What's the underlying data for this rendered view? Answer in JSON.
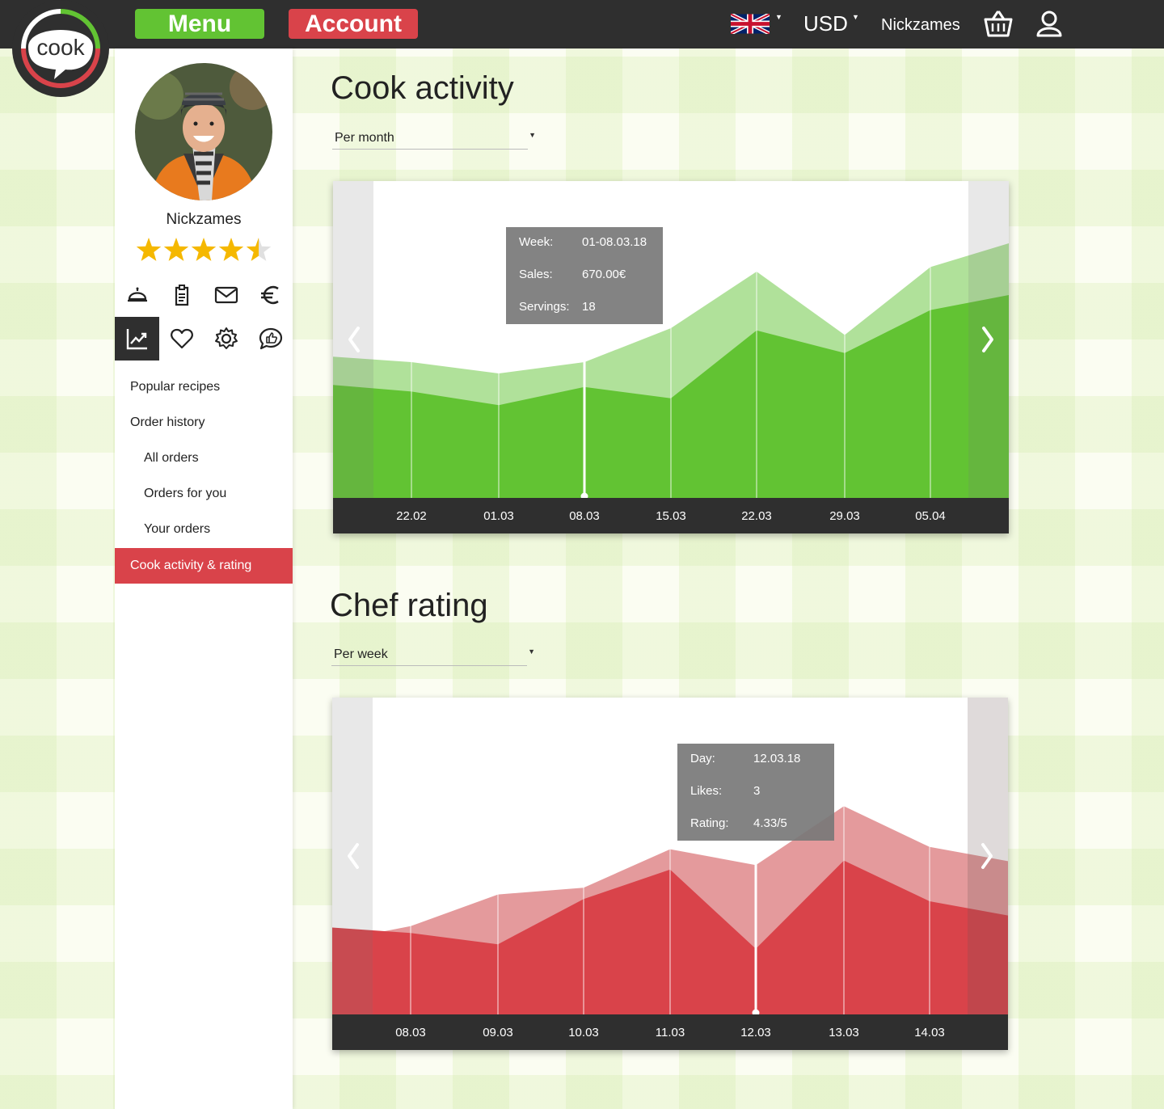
{
  "header": {
    "menu_label": "Menu",
    "account_label": "Account",
    "language_icon": "uk-flag-icon",
    "currency": "USD",
    "username": "Nickzames",
    "basket_icon": "basket-icon",
    "profile_icon": "user-icon"
  },
  "logo": {
    "text": "cook"
  },
  "sidebar": {
    "name": "Nickzames",
    "rating": 4.5,
    "rating_max": 5,
    "icons": [
      "cloche-icon",
      "clipboard-icon",
      "mail-icon",
      "euro-icon",
      "chart-icon",
      "heart-icon",
      "gear-icon",
      "chat-thumb-icon"
    ],
    "links": [
      "Popular recipes",
      "Order history",
      "All orders",
      "Orders for you",
      "Your orders"
    ],
    "active_link": "Cook activity & rating"
  },
  "activity": {
    "title": "Cook activity",
    "select_value": "Per month",
    "tooltip": {
      "week_label": "Week:",
      "week_value": "01-08.03.18",
      "sales_label": "Sales:",
      "sales_value": "670.00€",
      "servings_label": "Servings:",
      "servings_value": "18"
    }
  },
  "rating": {
    "title": "Chef rating",
    "select_value": "Per week",
    "tooltip": {
      "day_label": "Day:",
      "day_value": "12.03.18",
      "likes_label": "Likes:",
      "likes_value": "3",
      "rating_label": "Rating:",
      "rating_value": "4.33/5"
    }
  },
  "colors": {
    "green": "#62c333",
    "green_light": "#b0e19a",
    "red": "#d9434a",
    "red_light": "#e49a9c",
    "dark": "#2f2f2f"
  },
  "chart_data": [
    {
      "type": "area",
      "categories": [
        "22.02",
        "01.03",
        "08.03",
        "15.03",
        "22.03",
        "29.03",
        "05.04"
      ],
      "series": [
        {
          "values": [
            6,
            5.5,
            6,
            7.5,
            10,
            7.2,
            10.2
          ]
        },
        {
          "values": [
            4.7,
            4.1,
            4.9,
            4.4,
            7.4,
            6.4,
            8.3
          ]
        }
      ],
      "ylim": [
        0,
        14
      ],
      "grid": true
    },
    {
      "type": "area",
      "categories": [
        "08.03",
        "09.03",
        "10.03",
        "11.03",
        "12.03",
        "13.03",
        "14.03"
      ],
      "series": [
        {
          "values": [
            3.9,
            5.3,
            5.6,
            7.3,
            6.6,
            9.2,
            7.4
          ]
        },
        {
          "values": [
            3.6,
            3.1,
            5.1,
            6.4,
            2.9,
            6.8,
            5.0
          ]
        }
      ],
      "ylim": [
        0,
        14
      ],
      "grid": true
    }
  ]
}
